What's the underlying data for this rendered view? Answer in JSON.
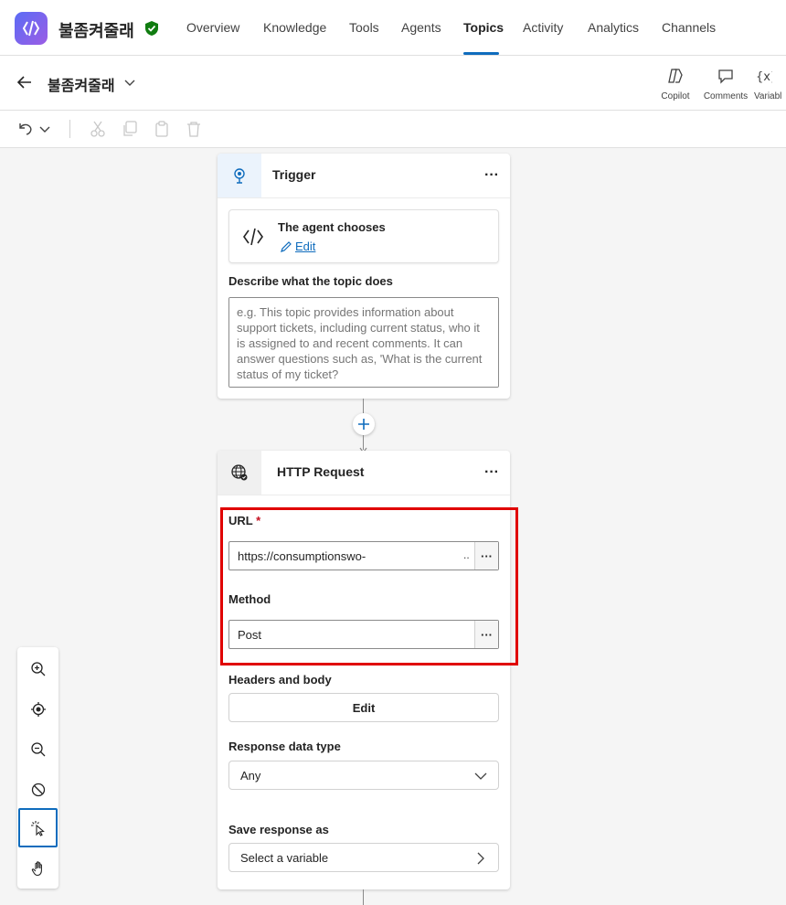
{
  "app": {
    "name": "불좀켜줄래"
  },
  "nav": {
    "tabs": [
      "Overview",
      "Knowledge",
      "Tools",
      "Agents",
      "Topics",
      "Activity",
      "Analytics",
      "Channels"
    ],
    "active": "Topics"
  },
  "topic": {
    "title": "불좀켜줄래"
  },
  "header_actions": {
    "copilot": "Copilot",
    "comments": "Comments",
    "variables": "Variabl"
  },
  "trigger": {
    "title": "Trigger",
    "more": "···",
    "agent_chooses": "The agent chooses",
    "edit": "Edit",
    "describe_label": "Describe what the topic does",
    "describe_placeholder": "e.g. This topic provides information about support tickets, including current status, who it is assigned to and recent comments. It can answer questions such as, 'What is the current status of my ticket?"
  },
  "http": {
    "title": "HTTP Request",
    "more": "···",
    "url_label": "URL",
    "url_required": "*",
    "url_value": "https://consumptionswo-",
    "url_ellipsis": "..",
    "method_label": "Method",
    "method_value": "Post",
    "field_more": "···",
    "headers_label": "Headers and body",
    "headers_button": "Edit",
    "response_label": "Response data type",
    "response_value": "Any",
    "save_label": "Save response as",
    "save_value": "Select a variable"
  },
  "colors": {
    "accent": "#0f6cbd",
    "highlight": "#e00000",
    "shield": "#107c10"
  }
}
